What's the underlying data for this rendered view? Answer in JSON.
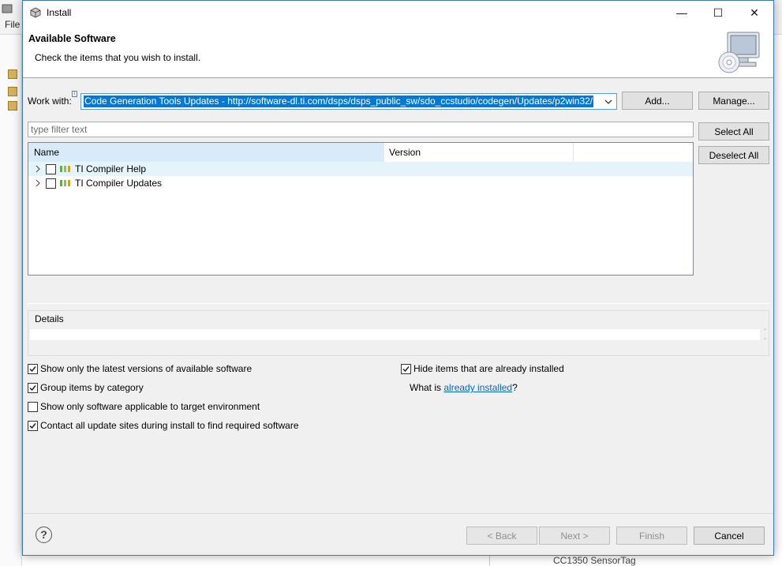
{
  "background_window": {
    "menu_file": "File",
    "bottom_text": "CC1350 SensorTag"
  },
  "dialog": {
    "title": "Install",
    "minimize_glyph": "—",
    "maximize_glyph": "☐",
    "close_glyph": "✕"
  },
  "header": {
    "title": "Available Software",
    "description": "Check the items that you wish to install."
  },
  "work_with": {
    "label": "Work with:",
    "value": "Code Generation Tools Updates - http://software-dl.ti.com/dsps/dsps_public_sw/sdo_ccstudio/codegen/Updates/p2win32/",
    "info_mark": "i"
  },
  "buttons": {
    "add": "Add...",
    "manage": "Manage...",
    "select_all": "Select All",
    "deselect_all": "Deselect All",
    "back": "< Back",
    "next": "Next >",
    "finish": "Finish",
    "cancel": "Cancel"
  },
  "filter": {
    "placeholder": "type filter text"
  },
  "table": {
    "columns": [
      "Name",
      "Version"
    ],
    "rows": [
      {
        "label": "TI Compiler Help",
        "checked": false
      },
      {
        "label": "TI Compiler Updates",
        "checked": false
      }
    ]
  },
  "details": {
    "label": "Details"
  },
  "options": {
    "latest_versions": {
      "label": "Show only the latest versions of available software",
      "checked": true
    },
    "group_by_category": {
      "label": "Group items by category",
      "checked": true
    },
    "applicable_only": {
      "label": "Show only software applicable to target environment",
      "checked": false
    },
    "contact_sites": {
      "label": "Contact all update sites during install to find required software",
      "checked": true
    },
    "hide_installed": {
      "label": "Hide items that are already installed",
      "checked": true
    },
    "what_is": "What is",
    "already_installed_link": "already installed",
    "question_mark": "?"
  },
  "help": {
    "glyph": "?"
  },
  "colors": {
    "selection": "#0078d7",
    "link": "#0066cc",
    "header_highlight": "#d9ebf9"
  }
}
